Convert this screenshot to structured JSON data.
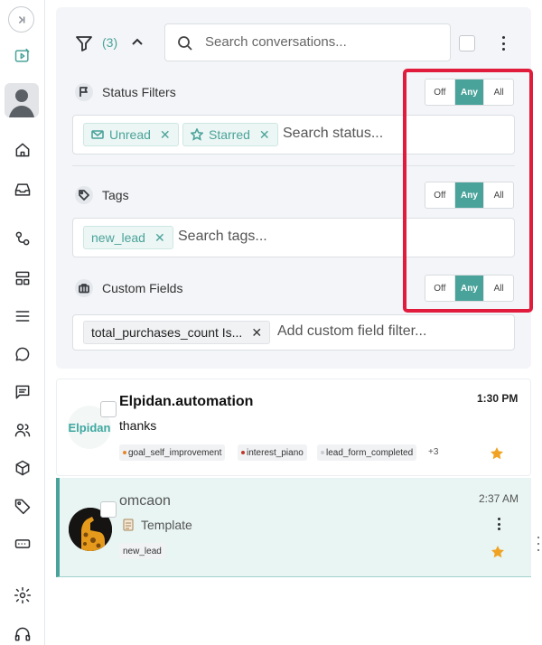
{
  "filters": {
    "count": "(3)",
    "search_placeholder": "Search conversations...",
    "status": {
      "label": "Status Filters",
      "toggle": [
        "Off",
        "Any",
        "All"
      ],
      "active": "Any",
      "chips": [
        "Unread",
        "Starred"
      ],
      "placeholder": "Search status..."
    },
    "tags": {
      "label": "Tags",
      "toggle": [
        "Off",
        "Any",
        "All"
      ],
      "active": "Any",
      "chips": [
        "new_lead"
      ],
      "placeholder": "Search tags..."
    },
    "custom": {
      "label": "Custom Fields",
      "toggle": [
        "Off",
        "Any",
        "All"
      ],
      "active": "Any",
      "chips": [
        "total_purchases_count Is..."
      ],
      "placeholder": "Add custom field filter..."
    }
  },
  "conversations": [
    {
      "name": "Elpidan.automation",
      "avatar_text": "Elpidan",
      "time": "1:30 PM",
      "message": "thanks",
      "tags": [
        {
          "label": "goal_self_improvement",
          "color": "#e8862a"
        },
        {
          "label": "interest_piano",
          "color": "#c0392b"
        },
        {
          "label": "lead_form_completed",
          "color": "#c9cdd2"
        }
      ],
      "more": "+3",
      "starred": true
    },
    {
      "name": "omcaon",
      "time": "2:37 AM",
      "message": "Template",
      "tags": [
        {
          "label": "new_lead"
        }
      ],
      "starred": true
    }
  ],
  "colors": {
    "accent": "#4aa39a",
    "highlight": "#e01b3c",
    "star": "#f0a323"
  }
}
